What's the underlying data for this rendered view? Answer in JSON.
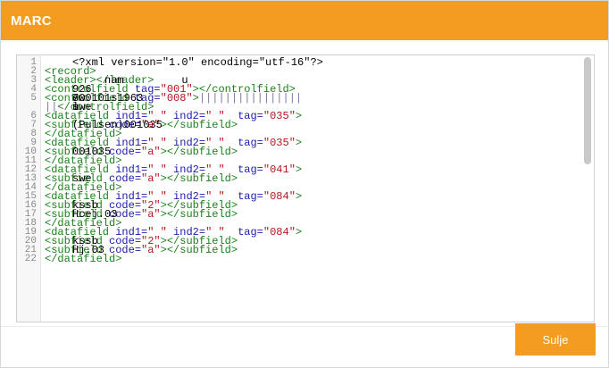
{
  "dialog": {
    "title": "MARC",
    "close_label": "Sulje"
  },
  "editor": {
    "lines": [
      {
        "n": "1",
        "segments": [
          {
            "t": "<?xml version=\"1.0\" encoding=\"utf-16\"?>",
            "c": "txt"
          }
        ]
      },
      {
        "n": "2",
        "segments": [
          {
            "t": "<record>",
            "c": "tag"
          }
        ]
      },
      {
        "n": "3",
        "segments": [
          {
            "t": "    ",
            "c": "txt"
          },
          {
            "t": "<leader>",
            "c": "tag"
          },
          {
            "t": "     nam         u     ",
            "c": "txt"
          },
          {
            "t": "</leader>",
            "c": "tag"
          }
        ]
      },
      {
        "n": "4",
        "segments": [
          {
            "t": "    ",
            "c": "txt"
          },
          {
            "t": "<controlfield ",
            "c": "tag"
          },
          {
            "t": "tag=",
            "c": "attr"
          },
          {
            "t": "\"001\"",
            "c": "val"
          },
          {
            "t": ">",
            "c": "tag"
          },
          {
            "t": "926",
            "c": "txt"
          },
          {
            "t": "</controlfield>",
            "c": "tag"
          }
        ]
      },
      {
        "n": "5",
        "segments": [
          {
            "t": "    ",
            "c": "txt"
          },
          {
            "t": "<controlfield ",
            "c": "tag"
          },
          {
            "t": "tag=",
            "c": "attr"
          },
          {
            "t": "\"008\"",
            "c": "val"
          },
          {
            "t": ">",
            "c": "tag"
          },
          {
            "t": "700101s1963",
            "c": "txt"
          },
          {
            "t": "||||",
            "c": "bar"
          },
          {
            "t": "sw ",
            "c": "txt"
          },
          {
            "t": "||||",
            "c": "bar"
          },
          {
            "t": "e",
            "c": "txt"
          },
          {
            "t": "||||||||",
            "c": "bar"
          }
        ]
      },
      {
        "n": "",
        "segments": [
          {
            "t": "l",
            "c": "txt"
          },
          {
            "t": "|",
            "c": "bar"
          },
          {
            "t": "swe",
            "c": "txt"
          },
          {
            "t": "|",
            "c": "bar"
          },
          {
            "t": "u",
            "c": "txt"
          },
          {
            "t": "</controlfield>",
            "c": "tag"
          }
        ]
      },
      {
        "n": "6",
        "segments": [
          {
            "t": "    ",
            "c": "txt"
          },
          {
            "t": "<datafield ",
            "c": "tag"
          },
          {
            "t": "ind1=",
            "c": "attr"
          },
          {
            "t": "\" \"",
            "c": "val"
          },
          {
            "t": " ind2=",
            "c": "attr"
          },
          {
            "t": "\" \"",
            "c": "val"
          },
          {
            "t": "  tag=",
            "c": "attr"
          },
          {
            "t": "\"035\"",
            "c": "val"
          },
          {
            "t": ">",
            "c": "tag"
          }
        ]
      },
      {
        "n": "7",
        "segments": [
          {
            "t": "      ",
            "c": "txt"
          },
          {
            "t": "<subfield ",
            "c": "tag"
          },
          {
            "t": "code=",
            "c": "attr"
          },
          {
            "t": "\"a\"",
            "c": "val"
          },
          {
            "t": ">",
            "c": "tag"
          },
          {
            "t": "(Pulsen)001035",
            "c": "txt"
          },
          {
            "t": "</subfield>",
            "c": "tag"
          }
        ]
      },
      {
        "n": "8",
        "segments": [
          {
            "t": "    ",
            "c": "txt"
          },
          {
            "t": "</datafield>",
            "c": "tag"
          }
        ]
      },
      {
        "n": "9",
        "segments": [
          {
            "t": "    ",
            "c": "txt"
          },
          {
            "t": "<datafield ",
            "c": "tag"
          },
          {
            "t": "ind1=",
            "c": "attr"
          },
          {
            "t": "\" \"",
            "c": "val"
          },
          {
            "t": " ind2=",
            "c": "attr"
          },
          {
            "t": "\" \"",
            "c": "val"
          },
          {
            "t": "  tag=",
            "c": "attr"
          },
          {
            "t": "\"035\"",
            "c": "val"
          },
          {
            "t": ">",
            "c": "tag"
          }
        ]
      },
      {
        "n": "10",
        "segments": [
          {
            "t": "      ",
            "c": "txt"
          },
          {
            "t": "<subfield ",
            "c": "tag"
          },
          {
            "t": "code=",
            "c": "attr"
          },
          {
            "t": "\"a\"",
            "c": "val"
          },
          {
            "t": ">",
            "c": "tag"
          },
          {
            "t": "001035",
            "c": "txt"
          },
          {
            "t": "</subfield>",
            "c": "tag"
          }
        ]
      },
      {
        "n": "11",
        "segments": [
          {
            "t": "    ",
            "c": "txt"
          },
          {
            "t": "</datafield>",
            "c": "tag"
          }
        ]
      },
      {
        "n": "12",
        "segments": [
          {
            "t": "    ",
            "c": "txt"
          },
          {
            "t": "<datafield ",
            "c": "tag"
          },
          {
            "t": "ind1=",
            "c": "attr"
          },
          {
            "t": "\" \"",
            "c": "val"
          },
          {
            "t": " ind2=",
            "c": "attr"
          },
          {
            "t": "\" \"",
            "c": "val"
          },
          {
            "t": "  tag=",
            "c": "attr"
          },
          {
            "t": "\"041\"",
            "c": "val"
          },
          {
            "t": ">",
            "c": "tag"
          }
        ]
      },
      {
        "n": "13",
        "segments": [
          {
            "t": "      ",
            "c": "txt"
          },
          {
            "t": "<subfield ",
            "c": "tag"
          },
          {
            "t": "code=",
            "c": "attr"
          },
          {
            "t": "\"a\"",
            "c": "val"
          },
          {
            "t": ">",
            "c": "tag"
          },
          {
            "t": "swe",
            "c": "txt"
          },
          {
            "t": "</subfield>",
            "c": "tag"
          }
        ]
      },
      {
        "n": "14",
        "segments": [
          {
            "t": "    ",
            "c": "txt"
          },
          {
            "t": "</datafield>",
            "c": "tag"
          }
        ]
      },
      {
        "n": "15",
        "segments": [
          {
            "t": "    ",
            "c": "txt"
          },
          {
            "t": "<datafield ",
            "c": "tag"
          },
          {
            "t": "ind1=",
            "c": "attr"
          },
          {
            "t": "\" \"",
            "c": "val"
          },
          {
            "t": " ind2=",
            "c": "attr"
          },
          {
            "t": "\" \"",
            "c": "val"
          },
          {
            "t": "  tag=",
            "c": "attr"
          },
          {
            "t": "\"084\"",
            "c": "val"
          },
          {
            "t": ">",
            "c": "tag"
          }
        ]
      },
      {
        "n": "16",
        "segments": [
          {
            "t": "      ",
            "c": "txt"
          },
          {
            "t": "<subfield ",
            "c": "tag"
          },
          {
            "t": "code=",
            "c": "attr"
          },
          {
            "t": "\"2\"",
            "c": "val"
          },
          {
            "t": ">",
            "c": "tag"
          },
          {
            "t": "kssb",
            "c": "txt"
          },
          {
            "t": "</subfield>",
            "c": "tag"
          }
        ]
      },
      {
        "n": "17",
        "segments": [
          {
            "t": "      ",
            "c": "txt"
          },
          {
            "t": "<subfield ",
            "c": "tag"
          },
          {
            "t": "code=",
            "c": "attr"
          },
          {
            "t": "\"a\"",
            "c": "val"
          },
          {
            "t": ">",
            "c": "tag"
          },
          {
            "t": "Hcej.03",
            "c": "txt"
          },
          {
            "t": "</subfield>",
            "c": "tag"
          }
        ]
      },
      {
        "n": "18",
        "segments": [
          {
            "t": "    ",
            "c": "txt"
          },
          {
            "t": "</datafield>",
            "c": "tag"
          }
        ]
      },
      {
        "n": "19",
        "segments": [
          {
            "t": "    ",
            "c": "txt"
          },
          {
            "t": "<datafield ",
            "c": "tag"
          },
          {
            "t": "ind1=",
            "c": "attr"
          },
          {
            "t": "\" \"",
            "c": "val"
          },
          {
            "t": " ind2=",
            "c": "attr"
          },
          {
            "t": "\" \"",
            "c": "val"
          },
          {
            "t": "  tag=",
            "c": "attr"
          },
          {
            "t": "\"084\"",
            "c": "val"
          },
          {
            "t": ">",
            "c": "tag"
          }
        ]
      },
      {
        "n": "20",
        "segments": [
          {
            "t": "      ",
            "c": "txt"
          },
          {
            "t": "<subfield ",
            "c": "tag"
          },
          {
            "t": "code=",
            "c": "attr"
          },
          {
            "t": "\"2\"",
            "c": "val"
          },
          {
            "t": ">",
            "c": "tag"
          },
          {
            "t": "kssb",
            "c": "txt"
          },
          {
            "t": "</subfield>",
            "c": "tag"
          }
        ]
      },
      {
        "n": "21",
        "segments": [
          {
            "t": "      ",
            "c": "txt"
          },
          {
            "t": "<subfield ",
            "c": "tag"
          },
          {
            "t": "code=",
            "c": "attr"
          },
          {
            "t": "\"a\"",
            "c": "val"
          },
          {
            "t": ">",
            "c": "tag"
          },
          {
            "t": "Hj.03",
            "c": "txt"
          },
          {
            "t": "</subfield>",
            "c": "tag"
          }
        ]
      },
      {
        "n": "22",
        "segments": [
          {
            "t": "    ",
            "c": "txt"
          },
          {
            "t": "</datafield>",
            "c": "tag"
          }
        ]
      }
    ]
  },
  "colors": {
    "accent": "#f39c1f",
    "tag": "#1a7f1a",
    "attr": "#1c1ca8",
    "value": "#b8161f"
  }
}
